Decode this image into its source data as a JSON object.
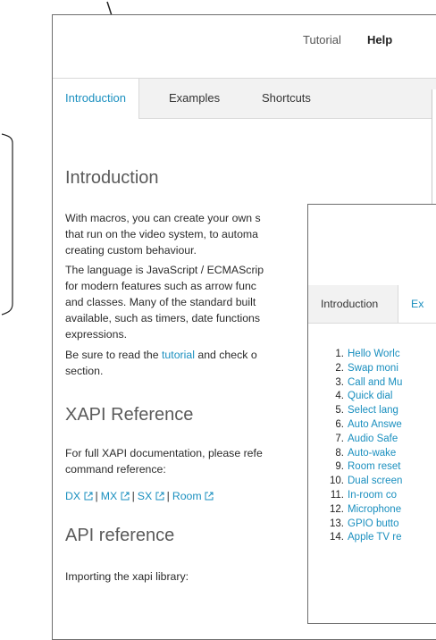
{
  "header": {
    "tutorial_label": "Tutorial",
    "help_label": "Help"
  },
  "tabs": [
    "Introduction",
    "Examples",
    "Shortcuts"
  ],
  "content": {
    "intro_title": "Introduction",
    "intro_p1_lines": [
      "With macros, you can create your own s",
      "that run on the video system, to automa",
      "creating custom behaviour."
    ],
    "intro_p2_lines": [
      "The language is JavaScript / ECMAScrip",
      "for modern features such as arrow func",
      "and classes. Many of the standard built",
      "available, such as timers, date functions",
      "expressions."
    ],
    "intro_p3_prefix": "Be sure to read the ",
    "intro_p3_link": "tutorial",
    "intro_p3_suffix": " and check o",
    "intro_p3_line2": "section.",
    "xapi_title": "XAPI Reference",
    "xapi_p_lines": [
      "For full XAPI documentation, please refe",
      "command reference:"
    ],
    "refs": [
      "DX",
      "MX",
      "SX",
      "Room"
    ],
    "api_title": "API reference",
    "api_p": "Importing the xapi library:"
  },
  "front": {
    "tabs": [
      "Introduction",
      "Ex"
    ],
    "examples": [
      {
        "num": "1.",
        "label": "Hello Worlc"
      },
      {
        "num": "2.",
        "label": "Swap moni"
      },
      {
        "num": "3.",
        "label": "Call and Mu"
      },
      {
        "num": "4.",
        "label": "Quick dial"
      },
      {
        "num": "5.",
        "label": "Select lang"
      },
      {
        "num": "6.",
        "label": "Auto Answe"
      },
      {
        "num": "7.",
        "label": "Audio Safe"
      },
      {
        "num": "8.",
        "label": "Auto-wake"
      },
      {
        "num": "9.",
        "label": "Room reset"
      },
      {
        "num": "10.",
        "label": "Dual screen"
      },
      {
        "num": "11.",
        "label": "In-room co"
      },
      {
        "num": "12.",
        "label": "Microphone"
      },
      {
        "num": "13.",
        "label": "GPIO butto"
      },
      {
        "num": "14.",
        "label": "Apple TV re"
      }
    ]
  }
}
